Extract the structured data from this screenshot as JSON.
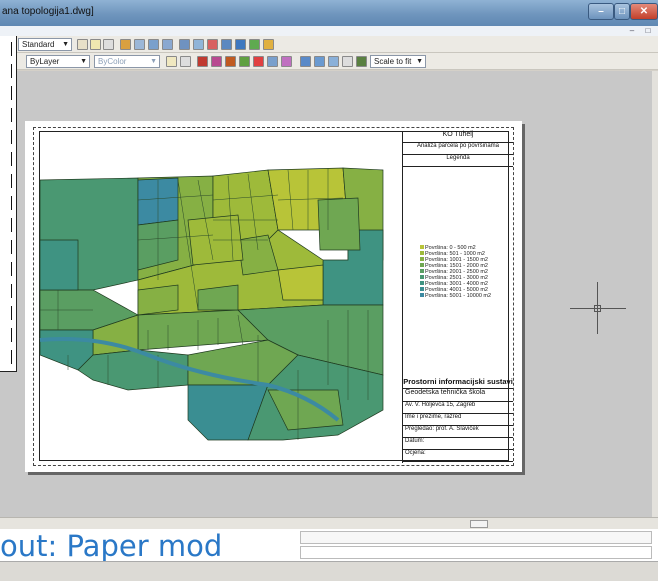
{
  "window": {
    "title": "ana topologija1.dwg]"
  },
  "toolbar1": {
    "text_style": "Standard"
  },
  "toolbar2": {
    "linetype": "ByLayer",
    "color": "ByColor",
    "scale": "Scale to fit"
  },
  "titleblock": {
    "header": "KO Tuhelj",
    "subtitle": "Analiza parcela po površinama",
    "legend_title": "Legenda",
    "legend": [
      {
        "label": "Površina:   0 -  500  m2",
        "color": "#b8c438"
      },
      {
        "label": "Površina:  501 - 1000  m2",
        "color": "#9eba3a"
      },
      {
        "label": "Površina: 1001 - 1500  m2",
        "color": "#86b044"
      },
      {
        "label": "Površina: 1501 - 2000  m2",
        "color": "#6fa752"
      },
      {
        "label": "Površina: 2001 - 2500  m2",
        "color": "#5a9e62"
      },
      {
        "label": "Površina: 2501 - 3000  m2",
        "color": "#4a9872"
      },
      {
        "label": "Površina: 3001 - 4000  m2",
        "color": "#3f9382"
      },
      {
        "label": "Površina: 4001 - 5000  m2",
        "color": "#3a8e92"
      },
      {
        "label": "Površina: 5001 - 10000  m2",
        "color": "#3c8aa2"
      }
    ],
    "org": "Prostorni informacijski sustavi",
    "school": "Geodetska tehnička škola",
    "address": "Av. V. Holjevca 15, Zagreb",
    "name_row": "Ime i prezime, razred",
    "reviewer": "Pregledao: prof. A. Slaviček",
    "date": "Datum:",
    "grade": "Ocjena:"
  },
  "footer": {
    "caption": "out: Paper mod"
  },
  "colors": {
    "accent": "#2a78c7"
  }
}
